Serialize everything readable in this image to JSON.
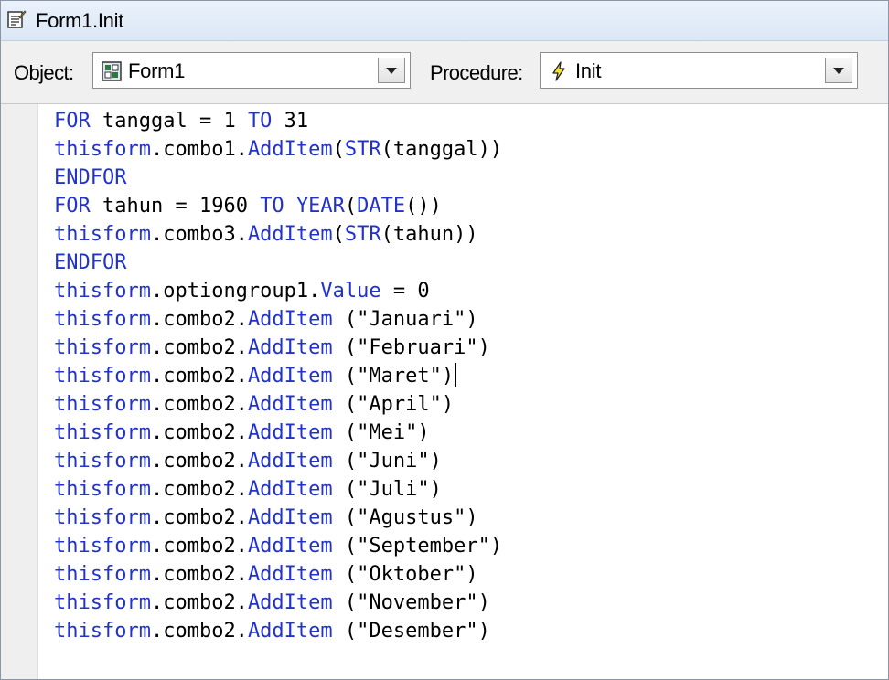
{
  "window": {
    "title": "Form1.Init",
    "icon": "form-code-icon"
  },
  "toolbar": {
    "object_label": "Object:",
    "object_value": "Form1",
    "object_icon": "form-object-icon",
    "procedure_label": "Procedure:",
    "procedure_value": "Init",
    "procedure_icon": "lightning-icon"
  },
  "code": {
    "lines": [
      [
        {
          "t": "FOR",
          "k": 1
        },
        {
          "t": " tanggal = 1 ",
          "k": 0
        },
        {
          "t": "TO",
          "k": 1
        },
        {
          "t": " 31",
          "k": 0
        }
      ],
      [
        {
          "t": "thisform",
          "k": 1
        },
        {
          "t": ".combo1.",
          "k": 0
        },
        {
          "t": "AddItem",
          "k": 1
        },
        {
          "t": "(",
          "k": 0
        },
        {
          "t": "STR",
          "k": 1
        },
        {
          "t": "(tanggal))",
          "k": 0
        }
      ],
      [
        {
          "t": "ENDFOR",
          "k": 1
        }
      ],
      [
        {
          "t": "FOR",
          "k": 1
        },
        {
          "t": " tahun = 1960 ",
          "k": 0
        },
        {
          "t": "TO",
          "k": 1
        },
        {
          "t": " ",
          "k": 0
        },
        {
          "t": "YEAR",
          "k": 1
        },
        {
          "t": "(",
          "k": 0
        },
        {
          "t": "DATE",
          "k": 1
        },
        {
          "t": "())",
          "k": 0
        }
      ],
      [
        {
          "t": "thisform",
          "k": 1
        },
        {
          "t": ".combo3.",
          "k": 0
        },
        {
          "t": "AddItem",
          "k": 1
        },
        {
          "t": "(",
          "k": 0
        },
        {
          "t": "STR",
          "k": 1
        },
        {
          "t": "(tahun))",
          "k": 0
        }
      ],
      [
        {
          "t": "ENDFOR",
          "k": 1
        }
      ],
      [
        {
          "t": "thisform",
          "k": 1
        },
        {
          "t": ".optiongroup1.",
          "k": 0
        },
        {
          "t": "Value",
          "k": 1
        },
        {
          "t": " = 0",
          "k": 0
        }
      ],
      [
        {
          "t": "thisform",
          "k": 1
        },
        {
          "t": ".combo2.",
          "k": 0
        },
        {
          "t": "AddItem",
          "k": 1
        },
        {
          "t": " (\"Januari\")",
          "k": 0
        }
      ],
      [
        {
          "t": "thisform",
          "k": 1
        },
        {
          "t": ".combo2.",
          "k": 0
        },
        {
          "t": "AddItem",
          "k": 1
        },
        {
          "t": " (\"Februari\")",
          "k": 0
        }
      ],
      [
        {
          "t": "thisform",
          "k": 1
        },
        {
          "t": ".combo2.",
          "k": 0
        },
        {
          "t": "AddItem",
          "k": 1
        },
        {
          "t": " (\"Maret\")",
          "k": 0
        }
      ],
      [
        {
          "t": "thisform",
          "k": 1
        },
        {
          "t": ".combo2.",
          "k": 0
        },
        {
          "t": "AddItem",
          "k": 1
        },
        {
          "t": " (\"April\")",
          "k": 0
        }
      ],
      [
        {
          "t": "thisform",
          "k": 1
        },
        {
          "t": ".combo2.",
          "k": 0
        },
        {
          "t": "AddItem",
          "k": 1
        },
        {
          "t": " (\"Mei\")",
          "k": 0
        }
      ],
      [
        {
          "t": "thisform",
          "k": 1
        },
        {
          "t": ".combo2.",
          "k": 0
        },
        {
          "t": "AddItem",
          "k": 1
        },
        {
          "t": " (\"Juni\")",
          "k": 0
        }
      ],
      [
        {
          "t": "thisform",
          "k": 1
        },
        {
          "t": ".combo2.",
          "k": 0
        },
        {
          "t": "AddItem",
          "k": 1
        },
        {
          "t": " (\"Juli\")",
          "k": 0
        }
      ],
      [
        {
          "t": "thisform",
          "k": 1
        },
        {
          "t": ".combo2.",
          "k": 0
        },
        {
          "t": "AddItem",
          "k": 1
        },
        {
          "t": " (\"Agustus\")",
          "k": 0
        }
      ],
      [
        {
          "t": "thisform",
          "k": 1
        },
        {
          "t": ".combo2.",
          "k": 0
        },
        {
          "t": "AddItem",
          "k": 1
        },
        {
          "t": " (\"September\")",
          "k": 0
        }
      ],
      [
        {
          "t": "thisform",
          "k": 1
        },
        {
          "t": ".combo2.",
          "k": 0
        },
        {
          "t": "AddItem",
          "k": 1
        },
        {
          "t": " (\"Oktober\")",
          "k": 0
        }
      ],
      [
        {
          "t": "thisform",
          "k": 1
        },
        {
          "t": ".combo2.",
          "k": 0
        },
        {
          "t": "AddItem",
          "k": 1
        },
        {
          "t": " (\"November\")",
          "k": 0
        }
      ],
      [
        {
          "t": "thisform",
          "k": 1
        },
        {
          "t": ".combo2.",
          "k": 0
        },
        {
          "t": "AddItem",
          "k": 1
        },
        {
          "t": " (\"Desember\")",
          "k": 0
        }
      ]
    ],
    "cursor_line": 10,
    "keyword_color": "#2233cc",
    "text_color": "#000000"
  }
}
